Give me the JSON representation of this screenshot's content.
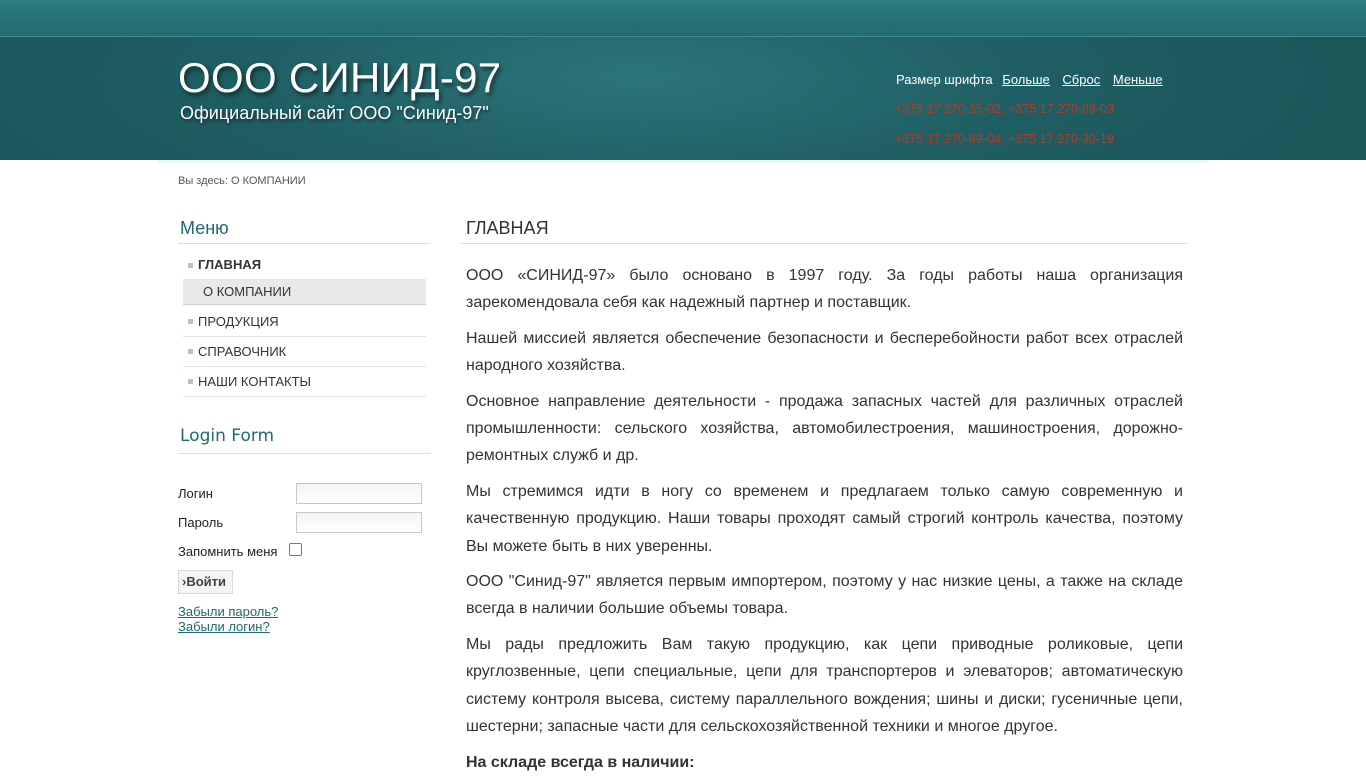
{
  "header": {
    "title": "ООО СИНИД-97",
    "subtitle": "Официальный сайт ООО \"Синид-97\"",
    "font_size_label": "Размер шрифта",
    "font_bigger": "Больше",
    "font_reset": "Сброс",
    "font_smaller": "Меньше",
    "phones_line1": "+375 17 270-35-02, +375 17 270-89-03",
    "phones_line2": "+375 17 270-89-04, +375 17 270-30-19"
  },
  "breadcrumb": "Вы здесь: О КОМПАНИИ",
  "menu": {
    "title": "Меню",
    "items": [
      {
        "label": "ГЛАВНАЯ"
      },
      {
        "label": "О КОМПАНИИ"
      },
      {
        "label": "ПРОДУКЦИЯ"
      },
      {
        "label": "СПРАВОЧНИК"
      },
      {
        "label": "НАШИ КОНТАКТЫ"
      }
    ]
  },
  "login": {
    "title": "Login Form",
    "username_label": "Логин",
    "password_label": "Пароль",
    "remember_label": "Запомнить меня",
    "submit_label": "›Войти",
    "forgot_password": "Забыли пароль?",
    "forgot_login": "Забыли логин?"
  },
  "main": {
    "title": "ГЛАВНАЯ",
    "paragraphs": [
      "ООО «СИНИД-97» было основано в 1997 году. За годы работы наша организация зарекомендовала себя как надежный партнер и поставщик.",
      "Нашей миссией является обеспечение безопасности и бесперебойности работ всех отраслей народного хозяйства.",
      "Основное направление деятельности - продажа запасных частей для различных отраслей промышленности: сельского хозяйства, автомобилестроения, машиностроения, дорожно-ремонтных служб и др.",
      "Мы стремимся идти в ногу со временем и предлагаем только самую современную и качественную продукцию. Наши товары проходят самый строгий контроль качества, поэтому Вы можете быть в них уверенны.",
      "ООО \"Синид-97\" является первым импортером, поэтому у нас низкие цены, а также на складе всегда в наличии большие объемы товара.",
      "Мы рады предложить Вам такую продукцию, как цепи приводные роликовые, цепи круглозвенные, цепи специальные, цепи для транспортеров и элеваторов; автоматическую систему контроля высева, систему параллельного вождения; шины и диски; гусеничные цепи, шестерни; запасные части для сельскохозяйственной техники и многое другое."
    ],
    "stock_heading": "На складе всегда в наличии:"
  },
  "colors": {
    "header_bg": "#1f5f64",
    "accent": "#1d6a6f",
    "phone_text": "#b23a2a"
  }
}
